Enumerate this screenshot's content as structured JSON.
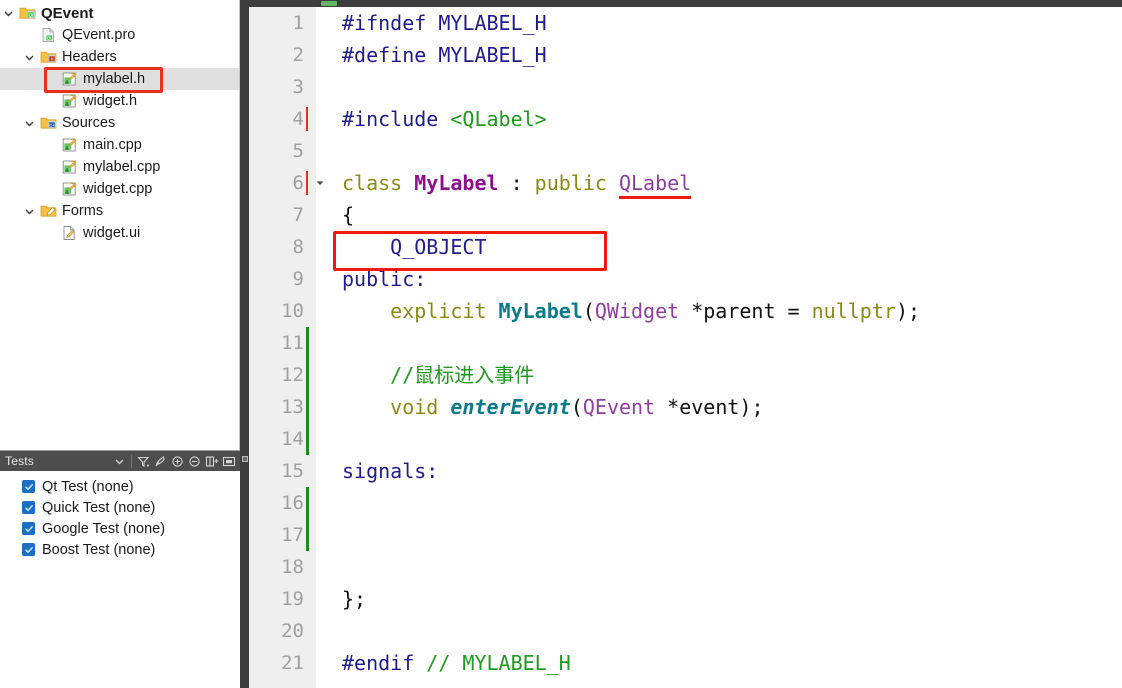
{
  "sidebar": {
    "project_tree": [
      {
        "label": "QEvent",
        "indent": 0,
        "arrow": "down",
        "icon": "qt-project-folder-icon",
        "bold": true,
        "selected": false
      },
      {
        "label": "QEvent.pro",
        "indent": 1,
        "arrow": "none",
        "icon": "qt-pro-file-icon",
        "bold": false,
        "selected": false
      },
      {
        "label": "Headers",
        "indent": 1,
        "arrow": "down",
        "icon": "headers-folder-icon",
        "bold": false,
        "selected": false
      },
      {
        "label": "mylabel.h",
        "indent": 2,
        "arrow": "none",
        "icon": "header-file-icon",
        "bold": false,
        "selected": true
      },
      {
        "label": "widget.h",
        "indent": 2,
        "arrow": "none",
        "icon": "header-file-icon",
        "bold": false,
        "selected": false
      },
      {
        "label": "Sources",
        "indent": 1,
        "arrow": "down",
        "icon": "sources-folder-icon",
        "bold": false,
        "selected": false
      },
      {
        "label": "main.cpp",
        "indent": 2,
        "arrow": "none",
        "icon": "source-file-icon",
        "bold": false,
        "selected": false
      },
      {
        "label": "mylabel.cpp",
        "indent": 2,
        "arrow": "none",
        "icon": "source-file-icon",
        "bold": false,
        "selected": false
      },
      {
        "label": "widget.cpp",
        "indent": 2,
        "arrow": "none",
        "icon": "source-file-icon",
        "bold": false,
        "selected": false
      },
      {
        "label": "Forms",
        "indent": 1,
        "arrow": "down",
        "icon": "forms-folder-icon",
        "bold": false,
        "selected": false
      },
      {
        "label": "widget.ui",
        "indent": 2,
        "arrow": "none",
        "icon": "ui-file-icon",
        "bold": false,
        "selected": false
      }
    ],
    "tests": {
      "title": "Tests",
      "toolbar": [
        "filter-dropdown-icon",
        "filter-icon",
        "run-icon",
        "expand-all-icon",
        "collapse-all-icon",
        "split-icon",
        "options-icon"
      ],
      "items": [
        {
          "label": "Qt Test (none)",
          "checked": true
        },
        {
          "label": "Quick Test (none)",
          "checked": true
        },
        {
          "label": "Google Test (none)",
          "checked": true
        },
        {
          "label": "Boost Test (none)",
          "checked": true
        }
      ]
    }
  },
  "editor": {
    "file": "mylabel.h",
    "lines": [
      {
        "num": "1",
        "changed": false,
        "cursor": false,
        "fold": false,
        "tokens": [
          {
            "t": "#ifndef ",
            "c": "t-pre"
          },
          {
            "t": "MYLABEL_H",
            "c": "t-macro"
          }
        ]
      },
      {
        "num": "2",
        "changed": false,
        "cursor": false,
        "fold": false,
        "tokens": [
          {
            "t": "#define ",
            "c": "t-pre"
          },
          {
            "t": "MYLABEL_H",
            "c": "t-macro"
          }
        ]
      },
      {
        "num": "3",
        "changed": false,
        "cursor": false,
        "fold": false,
        "tokens": []
      },
      {
        "num": "4",
        "changed": false,
        "cursor": true,
        "fold": false,
        "tokens": [
          {
            "t": "#include ",
            "c": "t-pre"
          },
          {
            "t": "<QLabel>",
            "c": "t-inc"
          }
        ]
      },
      {
        "num": "5",
        "changed": false,
        "cursor": false,
        "fold": false,
        "tokens": []
      },
      {
        "num": "6",
        "changed": false,
        "cursor": true,
        "fold": true,
        "tokens": [
          {
            "t": "class ",
            "c": "t-kw"
          },
          {
            "t": "MyLabel",
            "c": "t-cls"
          },
          {
            "t": " : ",
            "c": "t-plain"
          },
          {
            "t": "public ",
            "c": "t-kw"
          },
          {
            "t": "QLabel",
            "c": "t-typeu"
          }
        ]
      },
      {
        "num": "7",
        "changed": false,
        "cursor": false,
        "fold": false,
        "tokens": [
          {
            "t": "{",
            "c": "t-plain"
          }
        ]
      },
      {
        "num": "8",
        "changed": false,
        "cursor": false,
        "fold": false,
        "tokens": [
          {
            "t": "    Q_OBJECT",
            "c": "t-lbl"
          }
        ]
      },
      {
        "num": "9",
        "changed": false,
        "cursor": false,
        "fold": false,
        "tokens": [
          {
            "t": "public:",
            "c": "t-lbl"
          }
        ]
      },
      {
        "num": "10",
        "changed": false,
        "cursor": false,
        "fold": false,
        "tokens": [
          {
            "t": "    ",
            "c": "t-plain"
          },
          {
            "t": "explicit ",
            "c": "t-kw"
          },
          {
            "t": "MyLabel",
            "c": "t-fn"
          },
          {
            "t": "(",
            "c": "t-plain"
          },
          {
            "t": "QWidget",
            "c": "t-type"
          },
          {
            "t": " *parent = ",
            "c": "t-plain"
          },
          {
            "t": "nullptr",
            "c": "t-kw"
          },
          {
            "t": ");",
            "c": "t-plain"
          }
        ]
      },
      {
        "num": "11",
        "changed": true,
        "cursor": false,
        "fold": false,
        "tokens": []
      },
      {
        "num": "12",
        "changed": true,
        "cursor": false,
        "fold": false,
        "tokens": [
          {
            "t": "    //鼠标进入事件",
            "c": "t-cmt"
          }
        ]
      },
      {
        "num": "13",
        "changed": true,
        "cursor": false,
        "fold": false,
        "tokens": [
          {
            "t": "    ",
            "c": "t-plain"
          },
          {
            "t": "void ",
            "c": "t-kw"
          },
          {
            "t": "enterEvent",
            "c": "t-fni"
          },
          {
            "t": "(",
            "c": "t-plain"
          },
          {
            "t": "QEvent",
            "c": "t-type"
          },
          {
            "t": " *event);",
            "c": "t-plain"
          }
        ]
      },
      {
        "num": "14",
        "changed": true,
        "cursor": false,
        "fold": false,
        "tokens": []
      },
      {
        "num": "15",
        "changed": false,
        "cursor": false,
        "fold": false,
        "tokens": [
          {
            "t": "signals:",
            "c": "t-lbl"
          }
        ]
      },
      {
        "num": "16",
        "changed": true,
        "cursor": false,
        "fold": false,
        "tokens": []
      },
      {
        "num": "17",
        "changed": true,
        "cursor": false,
        "fold": false,
        "tokens": []
      },
      {
        "num": "18",
        "changed": false,
        "cursor": false,
        "fold": false,
        "tokens": []
      },
      {
        "num": "19",
        "changed": false,
        "cursor": false,
        "fold": false,
        "tokens": [
          {
            "t": "};",
            "c": "t-plain"
          }
        ]
      },
      {
        "num": "20",
        "changed": false,
        "cursor": false,
        "fold": false,
        "tokens": []
      },
      {
        "num": "21",
        "changed": false,
        "cursor": false,
        "fold": false,
        "tokens": [
          {
            "t": "#endif ",
            "c": "t-pre"
          },
          {
            "t": "// MYLABEL_H",
            "c": "t-cmt"
          }
        ]
      }
    ]
  },
  "annotations": {
    "highlight_color": "#f01a0a",
    "boxes": [
      "mylabel-h-tree-item",
      "include-qlabel-line"
    ],
    "underlines": [
      "qlabel-base-class"
    ]
  },
  "colors": {
    "selection_bg": "#e0e0e0",
    "gutter_bg": "#efefef",
    "panel_header_bg": "#4d4d4d",
    "change_marker": "#1f8a1f",
    "checkbox": "#1a6fc4"
  }
}
